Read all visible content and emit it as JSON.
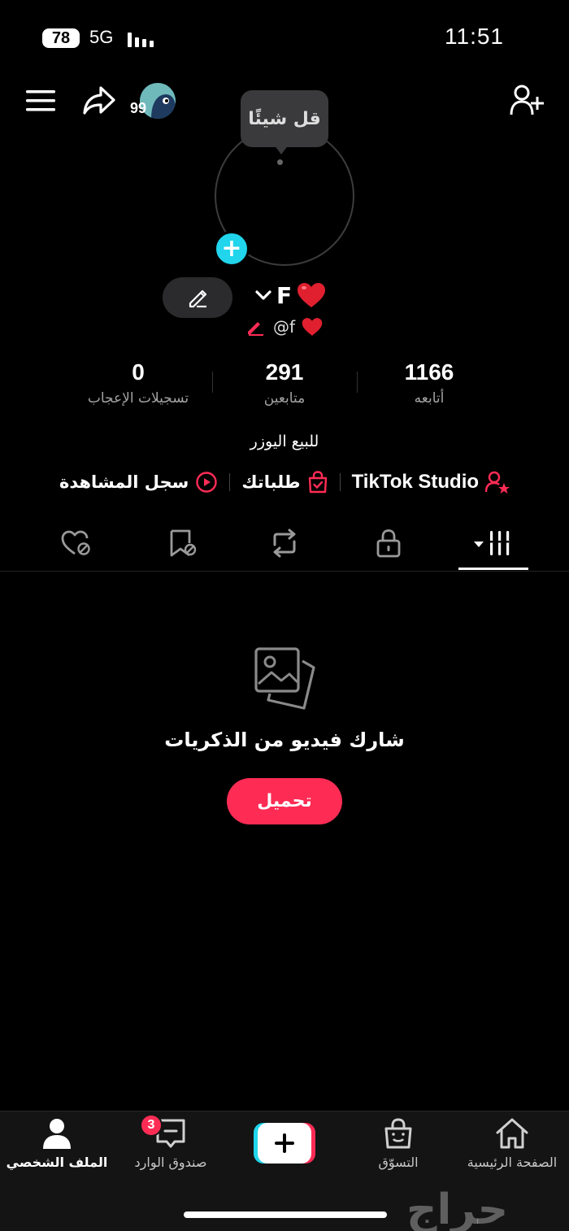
{
  "status_bar": {
    "battery": "78",
    "network": "5G",
    "time": "11:51"
  },
  "header": {
    "notifications_count": "99"
  },
  "profile": {
    "tooltip": "قل شيئًا",
    "display_name": "F",
    "handle": "@f",
    "bio": "للبيع اليوزر"
  },
  "stats": [
    {
      "value": "1166",
      "label": "أتابعه"
    },
    {
      "value": "291",
      "label": "متابعين"
    },
    {
      "value": "0",
      "label": "تسجيلات الإعجاب"
    }
  ],
  "links": {
    "studio": "TikTok Studio",
    "orders": "طلباتك",
    "history": "سجل المشاهدة"
  },
  "tabs": [
    {
      "icon": "grid-icon",
      "active": true
    },
    {
      "icon": "lock-icon",
      "active": false
    },
    {
      "icon": "repost-icon",
      "active": false
    },
    {
      "icon": "bookmark-icon",
      "active": false
    },
    {
      "icon": "liked-icon",
      "active": false
    }
  ],
  "empty_state": {
    "title": "شارك فيديو من الذكريات",
    "button": "تحميل"
  },
  "bottom_nav": {
    "home": "الصفحة الرئيسية",
    "shop": "التسوّق",
    "inbox": "صندوق الوارد",
    "inbox_badge": "3",
    "profile": "الملف الشخصي"
  },
  "watermark": "حراج",
  "colors": {
    "accent": "#fe2c55",
    "cyan": "#20d5ec",
    "background": "#000000"
  }
}
